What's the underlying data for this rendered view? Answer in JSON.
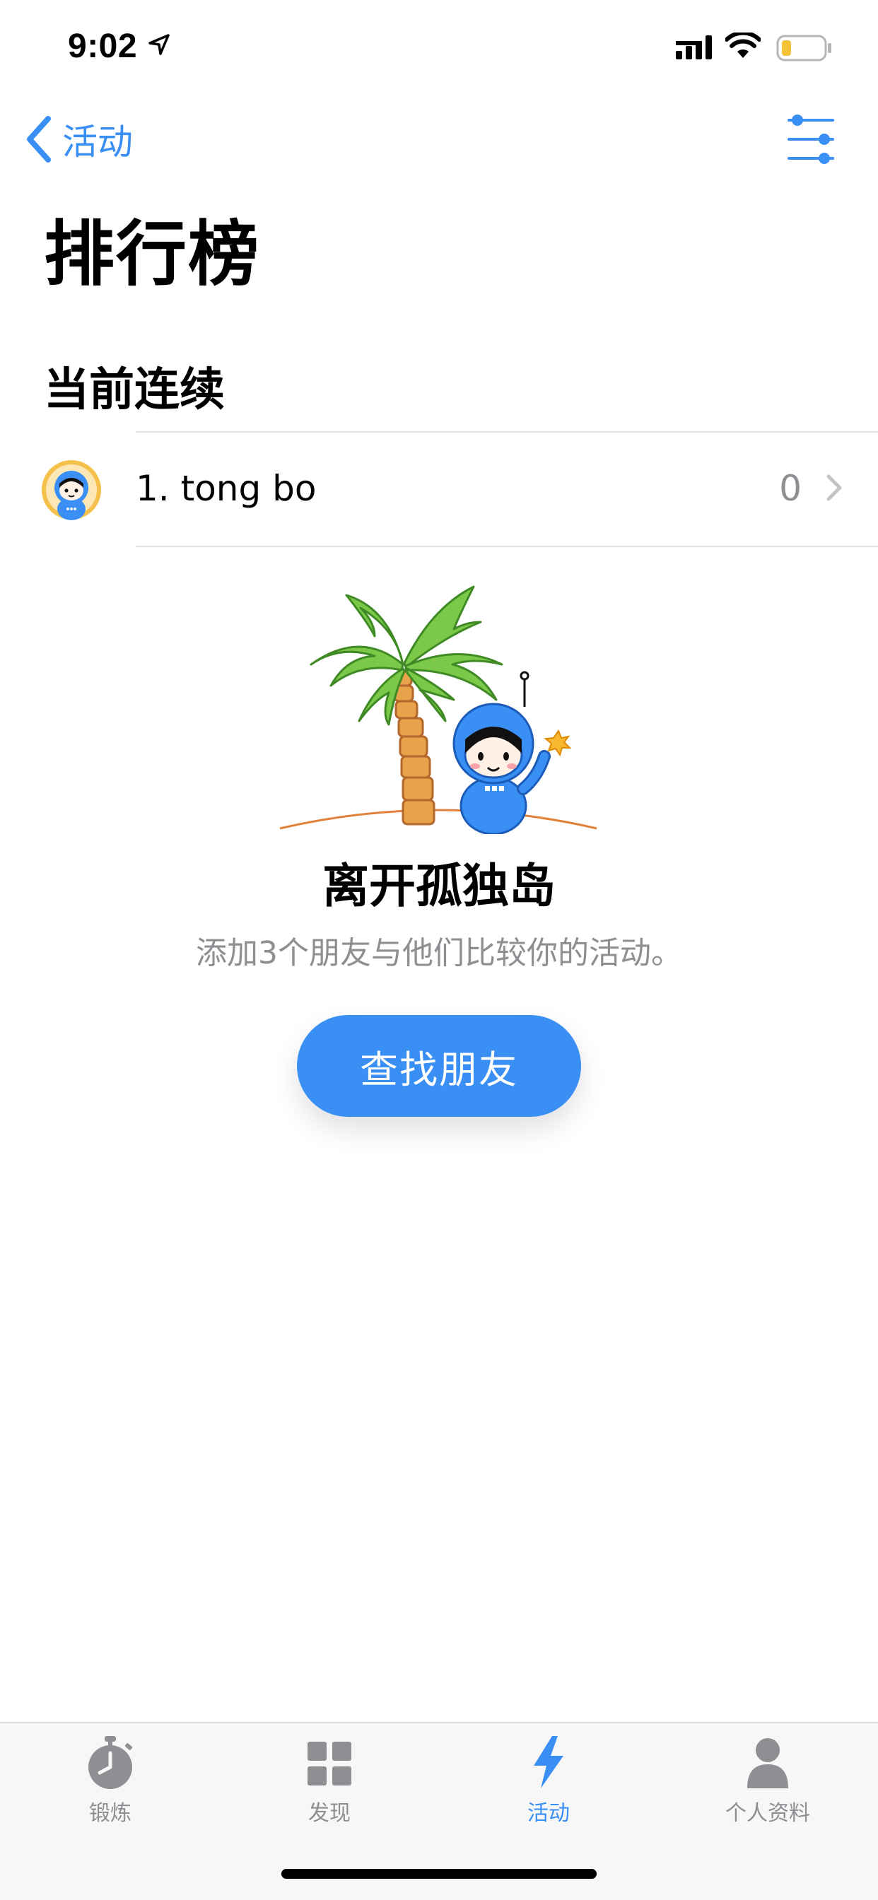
{
  "status_bar": {
    "time": "9:02"
  },
  "nav": {
    "back_label": "活动"
  },
  "page": {
    "title": "排行榜",
    "section_title": "当前连续"
  },
  "leaderboard": [
    {
      "rank_name": "1. tong bo",
      "score": "0"
    }
  ],
  "empty_state": {
    "title": "离开孤独岛",
    "subtitle": "添加3个朋友与他们比较你的活动。",
    "button_label": "查找朋友"
  },
  "tab_bar": {
    "items": [
      {
        "label": "锻炼",
        "icon": "stopwatch-icon",
        "active": false
      },
      {
        "label": "发现",
        "icon": "grid-icon",
        "active": false
      },
      {
        "label": "活动",
        "icon": "lightning-icon",
        "active": true
      },
      {
        "label": "个人资料",
        "icon": "person-icon",
        "active": false
      }
    ]
  },
  "colors": {
    "accent": "#3a8ff5",
    "secondary_text": "#8e8e93",
    "divider": "#e2e2e6"
  }
}
